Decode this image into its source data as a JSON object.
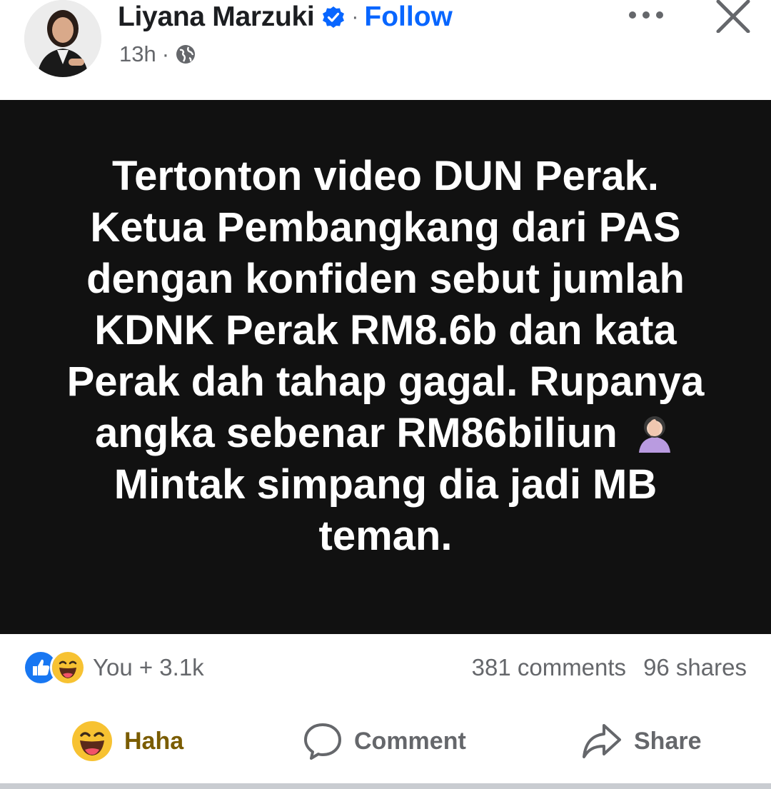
{
  "header": {
    "author_name": "Liyana Marzuki",
    "separator": "·",
    "follow_label": "Follow",
    "timestamp": "13h",
    "meta_separator": "·",
    "privacy_icon": "globe-icon",
    "verified_icon": "verified-badge-icon",
    "more_icon": "more-options-icon",
    "close_icon": "close-icon"
  },
  "post": {
    "lines": [
      "Tertonton video DUN Perak.",
      "Ketua Pembangkang dari PAS",
      "dengan konfiden sebut jumlah",
      "KDNK Perak RM8.6b dan kata",
      "Perak dah tahap gagal. Rupanya",
      "angka sebenar RM86biliun",
      "Mintak simpang dia jadi MB",
      "teman."
    ],
    "inline_emoji": "facepalm-emoji-icon",
    "background_color": "#111111",
    "text_color": "#ffffff"
  },
  "stats": {
    "reaction_icons": [
      "like-reaction-icon",
      "haha-reaction-icon"
    ],
    "reaction_summary": "You + 3.1k",
    "comments": "381 comments",
    "shares": "96 shares"
  },
  "actions": {
    "haha_label": "Haha",
    "comment_label": "Comment",
    "share_label": "Share"
  },
  "colors": {
    "accent": "#0866ff",
    "muted": "#65676b",
    "haha_text": "#7a5c00"
  }
}
